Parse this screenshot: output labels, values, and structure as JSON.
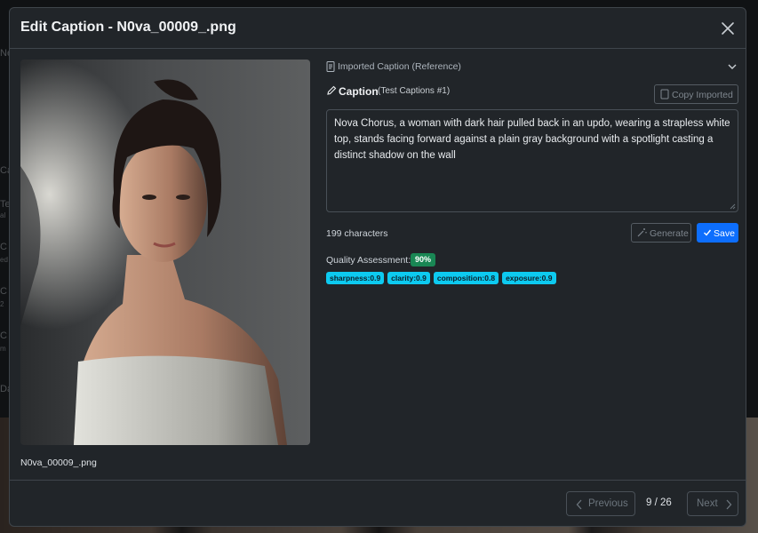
{
  "modal": {
    "title": "Edit Caption - N0va_00009_.png",
    "image_filename": "N0va_00009_.png"
  },
  "imported": {
    "label": "Imported Caption (Reference)"
  },
  "caption": {
    "label": "Caption",
    "context": "(Test Captions #1)",
    "copy_button": "Copy Imported",
    "text": "Nova Chorus, a woman with dark hair pulled back in an updo, wearing a strapless white top, stands facing forward against a plain gray background with a spotlight casting a distinct shadow on the wall",
    "char_count": "199 characters",
    "generate_button": "Generate",
    "save_button": "Save"
  },
  "quality": {
    "label": "Quality Assessment:",
    "score": "90%",
    "metrics": [
      "sharpness:0.9",
      "clarity:0.9",
      "composition:0.8",
      "exposure:0.9"
    ]
  },
  "footer": {
    "previous_button": "Previous",
    "page_indicator": "9 / 26",
    "next_button": "Next"
  },
  "background": {
    "letters": [
      "Ne",
      "Ca",
      "Te",
      "al",
      "C",
      "ed",
      "C",
      "2",
      "C",
      "m",
      "Da"
    ]
  },
  "colors": {
    "primary": "#0d6efd",
    "success": "#198754",
    "info": "#0dcaf0",
    "modal_bg": "#212529"
  }
}
